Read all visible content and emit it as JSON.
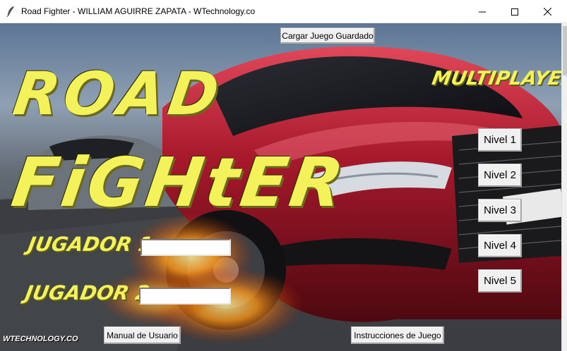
{
  "window": {
    "title": "Road Fighter - WILLIAM AGUIRRE ZAPATA - WTechnology.co"
  },
  "logo": {
    "line1": "ROAD",
    "line2": "FiGHtER"
  },
  "labels": {
    "multiplayer": "MULTIPLAYER",
    "jugador1": "JUGADOR 1",
    "jugador2": "JUGADOR 2",
    "watermark": "WTECHNOLOGY.CO"
  },
  "buttons": {
    "cargar": "Cargar Juego Guardado",
    "manual": "Manual de Usuario",
    "instrucciones": "Instrucciones de Juego"
  },
  "niveles": [
    "Nivel 1",
    "Nivel 2",
    "Nivel 3",
    "Nivel 4",
    "Nivel 5"
  ],
  "inputs": {
    "jugador1": {
      "value": ""
    },
    "jugador2": {
      "value": ""
    }
  }
}
